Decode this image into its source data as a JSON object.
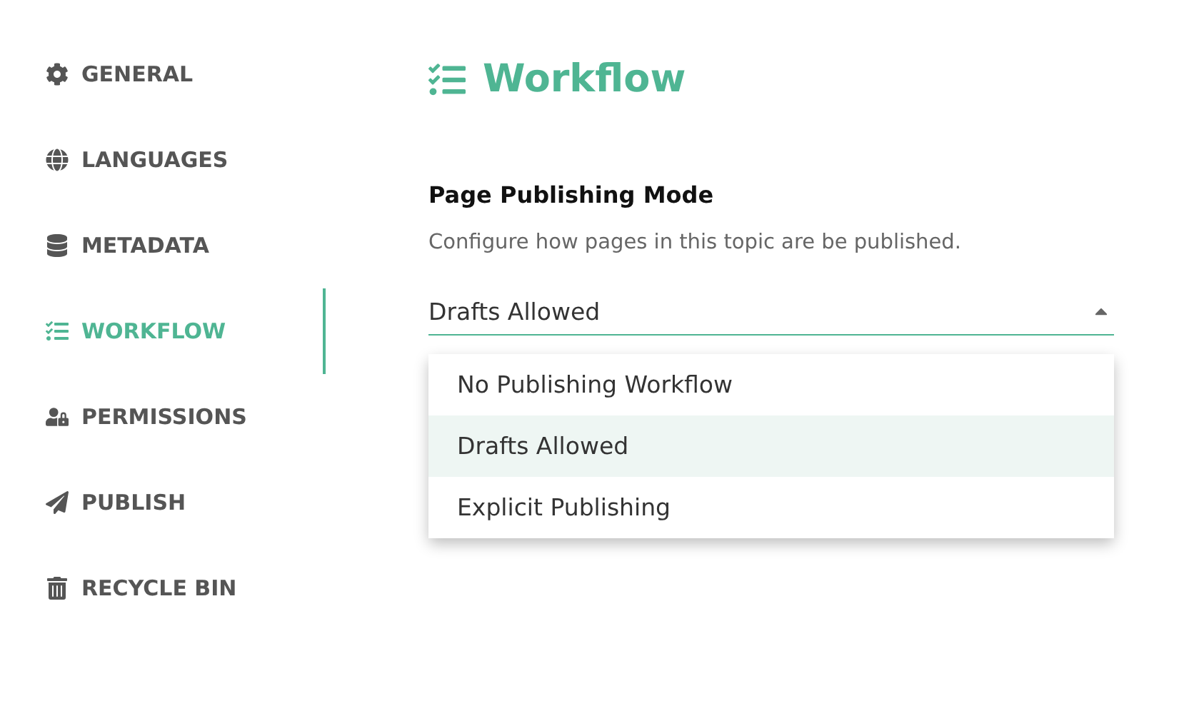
{
  "sidebar": {
    "items": [
      {
        "label": "GENERAL",
        "selected": false
      },
      {
        "label": "LANGUAGES",
        "selected": false
      },
      {
        "label": "METADATA",
        "selected": false
      },
      {
        "label": "WORKFLOW",
        "selected": true
      },
      {
        "label": "PERMISSIONS",
        "selected": false
      },
      {
        "label": "PUBLISH",
        "selected": false
      },
      {
        "label": "RECYCLE BIN",
        "selected": false
      }
    ]
  },
  "page": {
    "title": "Workflow",
    "field": {
      "label": "Page Publishing Mode",
      "description": "Configure how pages in this topic are be published.",
      "value": "Drafts Allowed",
      "expanded": true,
      "options": [
        {
          "label": "No Publishing Workflow",
          "selected": false
        },
        {
          "label": "Drafts Allowed",
          "selected": true
        },
        {
          "label": "Explicit Publishing",
          "selected": false
        }
      ]
    }
  }
}
